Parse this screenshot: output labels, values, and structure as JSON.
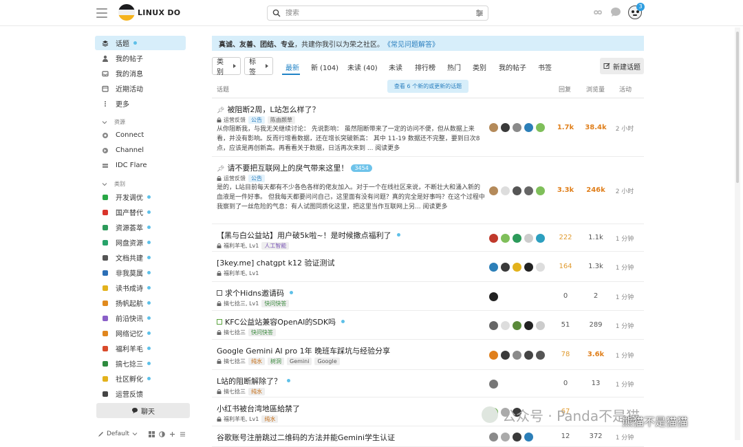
{
  "header": {
    "site_title": "LINUX DO",
    "search_placeholder": "搜索",
    "notification_count": "3"
  },
  "sidebar": {
    "main_items": [
      {
        "label": "话题",
        "icon": "layers-icon",
        "active": true,
        "dot": true
      },
      {
        "label": "我的帖子",
        "icon": "user-icon"
      },
      {
        "label": "我的消息",
        "icon": "inbox-icon"
      },
      {
        "label": "近期活动",
        "icon": "calendar-icon"
      },
      {
        "label": "更多",
        "icon": "more-vertical-icon"
      }
    ],
    "resources_heading": "资源",
    "resource_items": [
      {
        "label": "Connect",
        "icon": "connect-icon"
      },
      {
        "label": "Channel",
        "icon": "channel-icon"
      },
      {
        "label": "IDC Flare",
        "icon": "server-icon"
      }
    ],
    "categories_heading": "类别",
    "category_items": [
      {
        "label": "开发调优",
        "icon": "code-icon",
        "color": "#28a745"
      },
      {
        "label": "国产替代",
        "icon": "flower-icon",
        "color": "#d9342b"
      },
      {
        "label": "资源荟萃",
        "icon": "share-icon",
        "color": "#2c9a5a"
      },
      {
        "label": "网盘资源",
        "icon": "storage-icon",
        "color": "#27a36a"
      },
      {
        "label": "文档共建",
        "icon": "document-icon",
        "color": "#555555"
      },
      {
        "label": "非我莫属",
        "icon": "briefcase-icon",
        "color": "#2b6fb6"
      },
      {
        "label": "读书成诗",
        "icon": "books-icon",
        "color": "#e3b21c"
      },
      {
        "label": "扬帆起航",
        "icon": "rocket-icon",
        "color": "#e08a1e"
      },
      {
        "label": "前沿快讯",
        "icon": "news-icon",
        "color": "#8a5fc8"
      },
      {
        "label": "网络记忆",
        "icon": "rss-icon",
        "color": "#e0861e"
      },
      {
        "label": "福利羊毛",
        "icon": "gift-icon",
        "color": "#d94a2b"
      },
      {
        "label": "搞七捻三",
        "icon": "tree-icon",
        "color": "#2d8a3e"
      },
      {
        "label": "社区孵化",
        "icon": "bulb-icon",
        "color": "#e3b21c"
      },
      {
        "label": "运营反馈",
        "icon": "chat-bubbles-icon",
        "color": "#444444"
      }
    ],
    "chat_label": "聊天",
    "theme_label": "Default"
  },
  "banner": {
    "bold": "真诚、友善、团结、专业",
    "text": "，共建你我引以为荣之社区。",
    "link": "《常见问题解答》"
  },
  "filters": {
    "category": "类别",
    "tags": "标签"
  },
  "tabs": [
    "最新",
    "新 (104)",
    "未读 (40)",
    "未读",
    "排行榜",
    "热门",
    "类别",
    "我的帖子",
    "书签"
  ],
  "new_topic_label": "新建话题",
  "columns": {
    "topic": "话题",
    "replies": "回复",
    "views": "浏览量",
    "activity": "活动"
  },
  "new_topics_pill": "查看 6 个新的或更新的话题",
  "topics": [
    {
      "title": "被阻断2周，L站怎么样了？",
      "pinned": true,
      "category": "运营反馈",
      "tags": [
        {
          "t": "公告",
          "c": "blue"
        },
        {
          "t": "陈由颜草",
          "c": ""
        }
      ],
      "excerpt": "从你阻断我，与我无关继续讨论： 先说影响： 虽然阻断带来了一定的访问不便，但从数据上来看，并没有影响。反而行增看数据，还在增长突破新高： 其中 11-19 数据还不完整，要到日次8点，应该是再创新高。再看看关于数据，日活再次来到 ... 阅读更多",
      "replies": "1.7k",
      "views": "38.4k",
      "activity": "2 小时",
      "avatars": [
        "#b48a5a",
        "#3a3a3a",
        "#8a8a8a",
        "#2c7fb8",
        "#7fbf5a"
      ]
    },
    {
      "title": "请不要把互联网上的戾气带来这里！",
      "pinned": true,
      "badge": "3454",
      "category": "运营反馈",
      "tags": [
        {
          "t": "公告",
          "c": "blue"
        }
      ],
      "excerpt": "是的，L站目前每天都有不少各色各样的佬友加入。对于一个在线社区来说，不断壮大和涌入新的血液是一件好事。 但我每天都要问问自己，这里面有没有问题？真的完全是好事吗？在这个过程中我察到了一丝危险的气息：有人试图同质化这里，把这里当作互联网上另... 阅读更多",
      "replies": "3.3k",
      "views": "246k",
      "activity": "2 小时",
      "avatars": [
        "#b48a5a",
        "#dddddd",
        "#555555",
        "#666666",
        "#7fbf5a"
      ]
    },
    {
      "title": "【黑与白公益站】用户破5k啦~！是时候撒点福利了",
      "live": true,
      "category": "福利羊毛, Lv1",
      "tags": [
        {
          "t": "人工智能",
          "c": "purple"
        }
      ],
      "replies": "222",
      "views": "1.1k",
      "activity": "1 分钟",
      "avatars": [
        "#c0392b",
        "#7fbf5a",
        "#2c9a5a",
        "#cccccc",
        "#2c9fbf"
      ]
    },
    {
      "title": "[3key.me] chatgpt k12 验证测试",
      "category": "福利羊毛, Lv1",
      "tags": [],
      "replies": "164",
      "views": "1.3k",
      "activity": "1 分钟",
      "avatars": [
        "#2c7fb8",
        "#3a3a3a",
        "#e3b21c",
        "#222222",
        "#dddddd"
      ]
    },
    {
      "title": "求个Hidns邀请码",
      "check": "open",
      "live": true,
      "category": "搞七捻三, Lv1",
      "tags": [
        {
          "t": "快问快答",
          "c": "green"
        }
      ],
      "replies": "0",
      "views": "2",
      "activity": "1 分钟",
      "avatars": [
        "#222222"
      ]
    },
    {
      "title": "KFC公益站兼容OpenAI的SDK吗",
      "check": "done",
      "live": true,
      "category": "搞七捻三",
      "tags": [
        {
          "t": "快问快答",
          "c": "green"
        }
      ],
      "replies": "51",
      "views": "289",
      "activity": "1 分钟",
      "avatars": [
        "#666666",
        "#dddddd",
        "#5a8a3a",
        "#222222",
        "#cccccc"
      ]
    },
    {
      "title": "Google Gemini AI pro 1年 晚班车踩坑与经验分享",
      "category": "搞七捻三",
      "tags": [
        {
          "t": "纯水",
          "c": "orange"
        },
        {
          "t": "树洞",
          "c": "green"
        },
        {
          "t": "Gemini",
          "c": ""
        },
        {
          "t": "Google",
          "c": ""
        }
      ],
      "replies": "78",
      "views": "3.6k",
      "activity": "1 分钟",
      "avatars": [
        "#e07f1b",
        "#3a3a3a",
        "#8a8a8a",
        "#444444",
        "#555555"
      ]
    },
    {
      "title": "L站的阻断解除了？",
      "live": true,
      "category": "搞七捻三",
      "tags": [
        {
          "t": "纯水",
          "c": "orange"
        }
      ],
      "replies": "0",
      "views": "13",
      "activity": "1 分钟",
      "avatars": [
        "#777777"
      ]
    },
    {
      "title": "小红书被台湾地區給禁了",
      "category": "福利羊毛, Lv1",
      "tags": [
        {
          "t": "纯水",
          "c": "orange"
        }
      ],
      "replies": "67",
      "views": "",
      "activity": "",
      "avatars": [
        "#5aa33d",
        "#aaaaaa",
        "#3a3a3a"
      ]
    },
    {
      "title": "谷歌账号注册跳过二维码的方法并能Gemini学生认证",
      "category": "",
      "tags": [],
      "replies": "12",
      "views": "372",
      "activity": "1 分钟",
      "avatars": [
        "#8a8a8a",
        "#aaaaaa",
        "#3a3a3a",
        "#2c7fb8"
      ]
    }
  ],
  "watermark": {
    "text": "公众号 · Panda不是猫",
    "bottom": "熊猫不是猫猫"
  },
  "colors": {
    "accent": "#1f82c6",
    "highlight_bg": "#d7eefa",
    "hot": "#e07f1b"
  }
}
